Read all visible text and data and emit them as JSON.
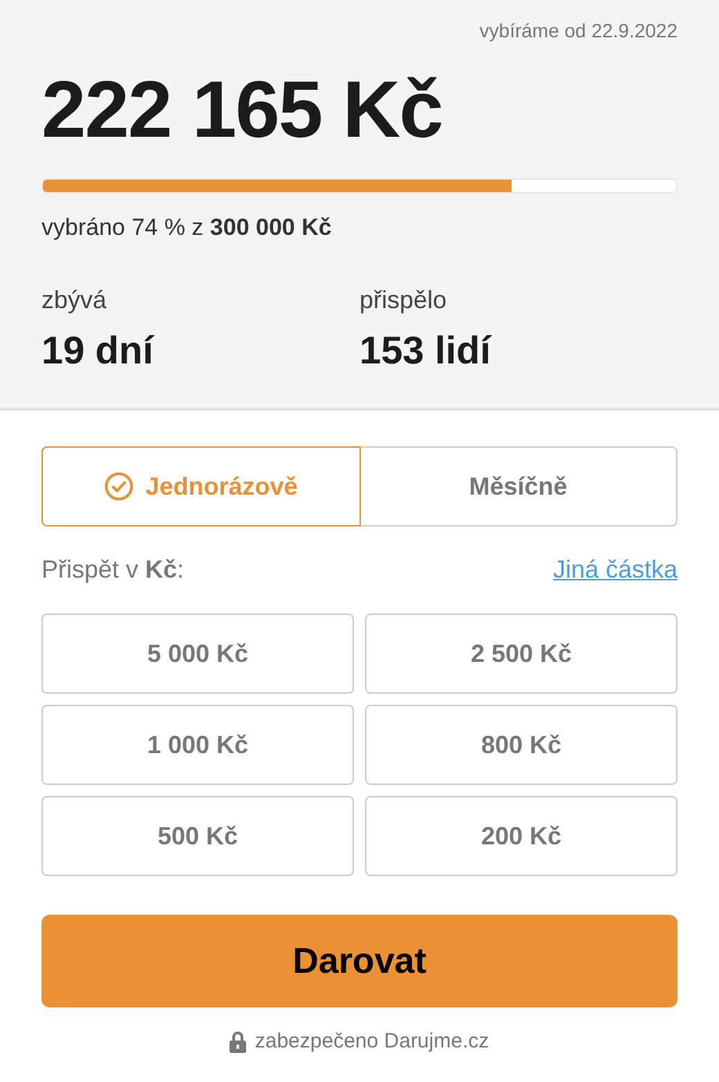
{
  "campaign": {
    "since": "vybíráme od 22.9.2022",
    "raised": "222 165 Kč",
    "progress": {
      "level": 0.74
    },
    "summary": "vybráno 74 % z **300 000 Kč**",
    "stats": [
      {
        "label": "zbývá",
        "value": "19 dní"
      },
      {
        "label": "přispělo",
        "value": "153 lidí"
      }
    ]
  },
  "frequency_tabs": [
    {
      "label": "Jednorázově",
      "selected": true
    },
    {
      "label": "Měsíčně",
      "selected": false
    }
  ],
  "amount_label": "Přispět v **Kč**:",
  "other_amount_link": "Jiná částka",
  "amounts": [
    {
      "label": "5 000 Kč",
      "selected": false
    },
    {
      "label": "2 500 Kč",
      "selected": false
    },
    {
      "label": "1 000 Kč",
      "selected": false
    },
    {
      "label": "800 Kč",
      "selected": false
    },
    {
      "label": "500 Kč",
      "selected": false
    },
    {
      "label": "200 Kč",
      "selected": false
    }
  ],
  "donate_button": "Darovat",
  "footer": "zabezpečeno Darujme.cz"
}
